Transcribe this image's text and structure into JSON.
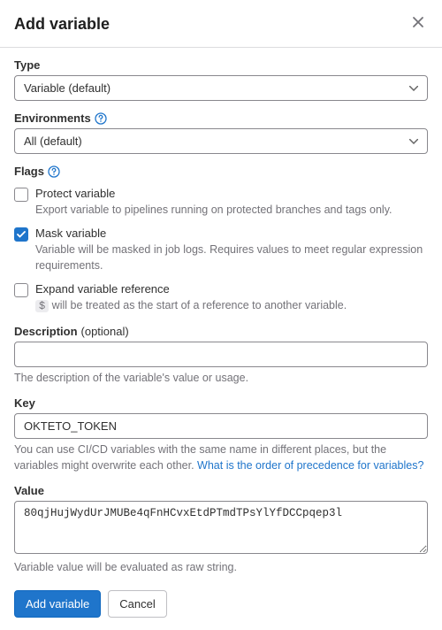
{
  "header": {
    "title": "Add variable"
  },
  "type": {
    "label": "Type",
    "value": "Variable (default)"
  },
  "environments": {
    "label": "Environments",
    "value": "All (default)"
  },
  "flags": {
    "label": "Flags",
    "protect": {
      "label": "Protect variable",
      "help": "Export variable to pipelines running on protected branches and tags only.",
      "checked": false
    },
    "mask": {
      "label": "Mask variable",
      "help": "Variable will be masked in job logs. Requires values to meet regular expression requirements.",
      "checked": true
    },
    "expand": {
      "label": "Expand variable reference",
      "help_prefix": "$",
      "help_suffix": " will be treated as the start of a reference to another variable.",
      "checked": false
    }
  },
  "description": {
    "label": "Description",
    "optional": "(optional)",
    "value": "",
    "help": "The description of the variable's value or usage."
  },
  "key": {
    "label": "Key",
    "value": "OKTETO_TOKEN",
    "help_prefix": "You can use CI/CD variables with the same name in different places, but the variables might overwrite each other. ",
    "help_link": "What is the order of precedence for variables?"
  },
  "value": {
    "label": "Value",
    "value": "80qjHujWydUrJMUBe4qFnHCvxEtdPTmdTPsYlYfDCCpqep3l",
    "help": "Variable value will be evaluated as raw string."
  },
  "actions": {
    "submit": "Add variable",
    "cancel": "Cancel"
  }
}
